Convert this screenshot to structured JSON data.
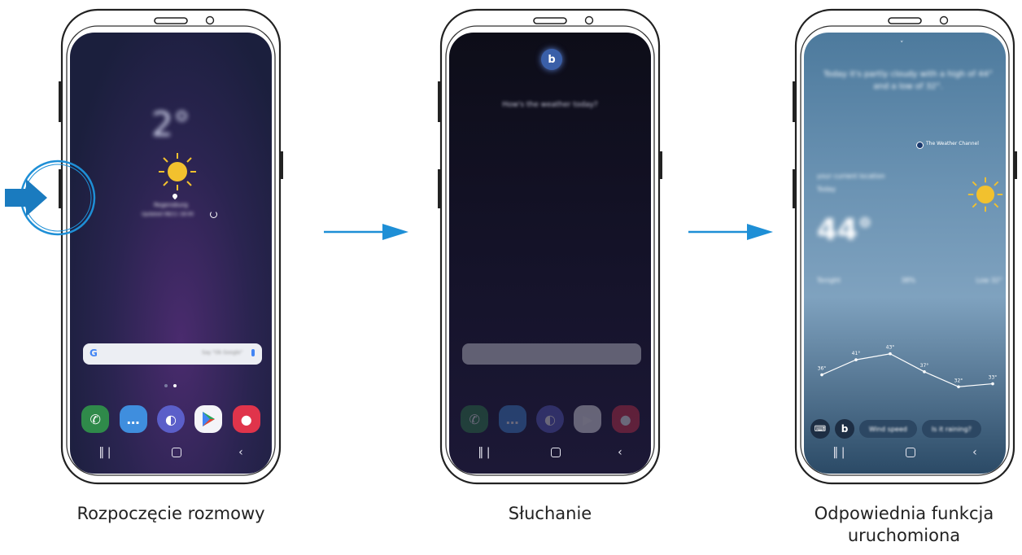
{
  "steps": [
    {
      "caption": "Rozpoczęcie rozmowy",
      "screen": {
        "temperature": "2°",
        "location": "Regensburg",
        "updated": "Updated 08/11 18:00",
        "weather_icon": "sun-icon",
        "search_hint": "Say \"Ok Google\"",
        "apps": [
          "phone-icon",
          "messages-icon",
          "internet-icon",
          "play-store-icon",
          "camera-icon"
        ]
      }
    },
    {
      "caption": "Słuchanie",
      "screen": {
        "query": "How's the weather today?",
        "bixby_icon": "bixby-icon"
      }
    },
    {
      "caption": "Odpowiednia funkcja uruchomiona",
      "caption_line1": "Odpowiednia funkcja",
      "caption_line2": "uruchomiona",
      "screen": {
        "response": "Today it's partly cloudy with a high of 44° and a low of 32°.",
        "source": "The Weather Channel",
        "location": "your current location",
        "day": "Today",
        "temperature": "44°",
        "stats": [
          "Tonight",
          "38%",
          "Low 32°"
        ],
        "chart": {
          "points": [
            {
              "label": "36°",
              "value": 36
            },
            {
              "label": "41°",
              "value": 41
            },
            {
              "label": "43°",
              "value": 43
            },
            {
              "label": "37°",
              "value": 37
            },
            {
              "label": "32°",
              "value": 32
            },
            {
              "label": "33°",
              "value": 33
            }
          ]
        },
        "suggestions": [
          "Wind speed",
          "Is it raining?"
        ]
      }
    }
  ],
  "colors": {
    "arrow": "#1e8fd6",
    "press_arrow": "#1a7bbf",
    "sun": "#f2c12e"
  }
}
